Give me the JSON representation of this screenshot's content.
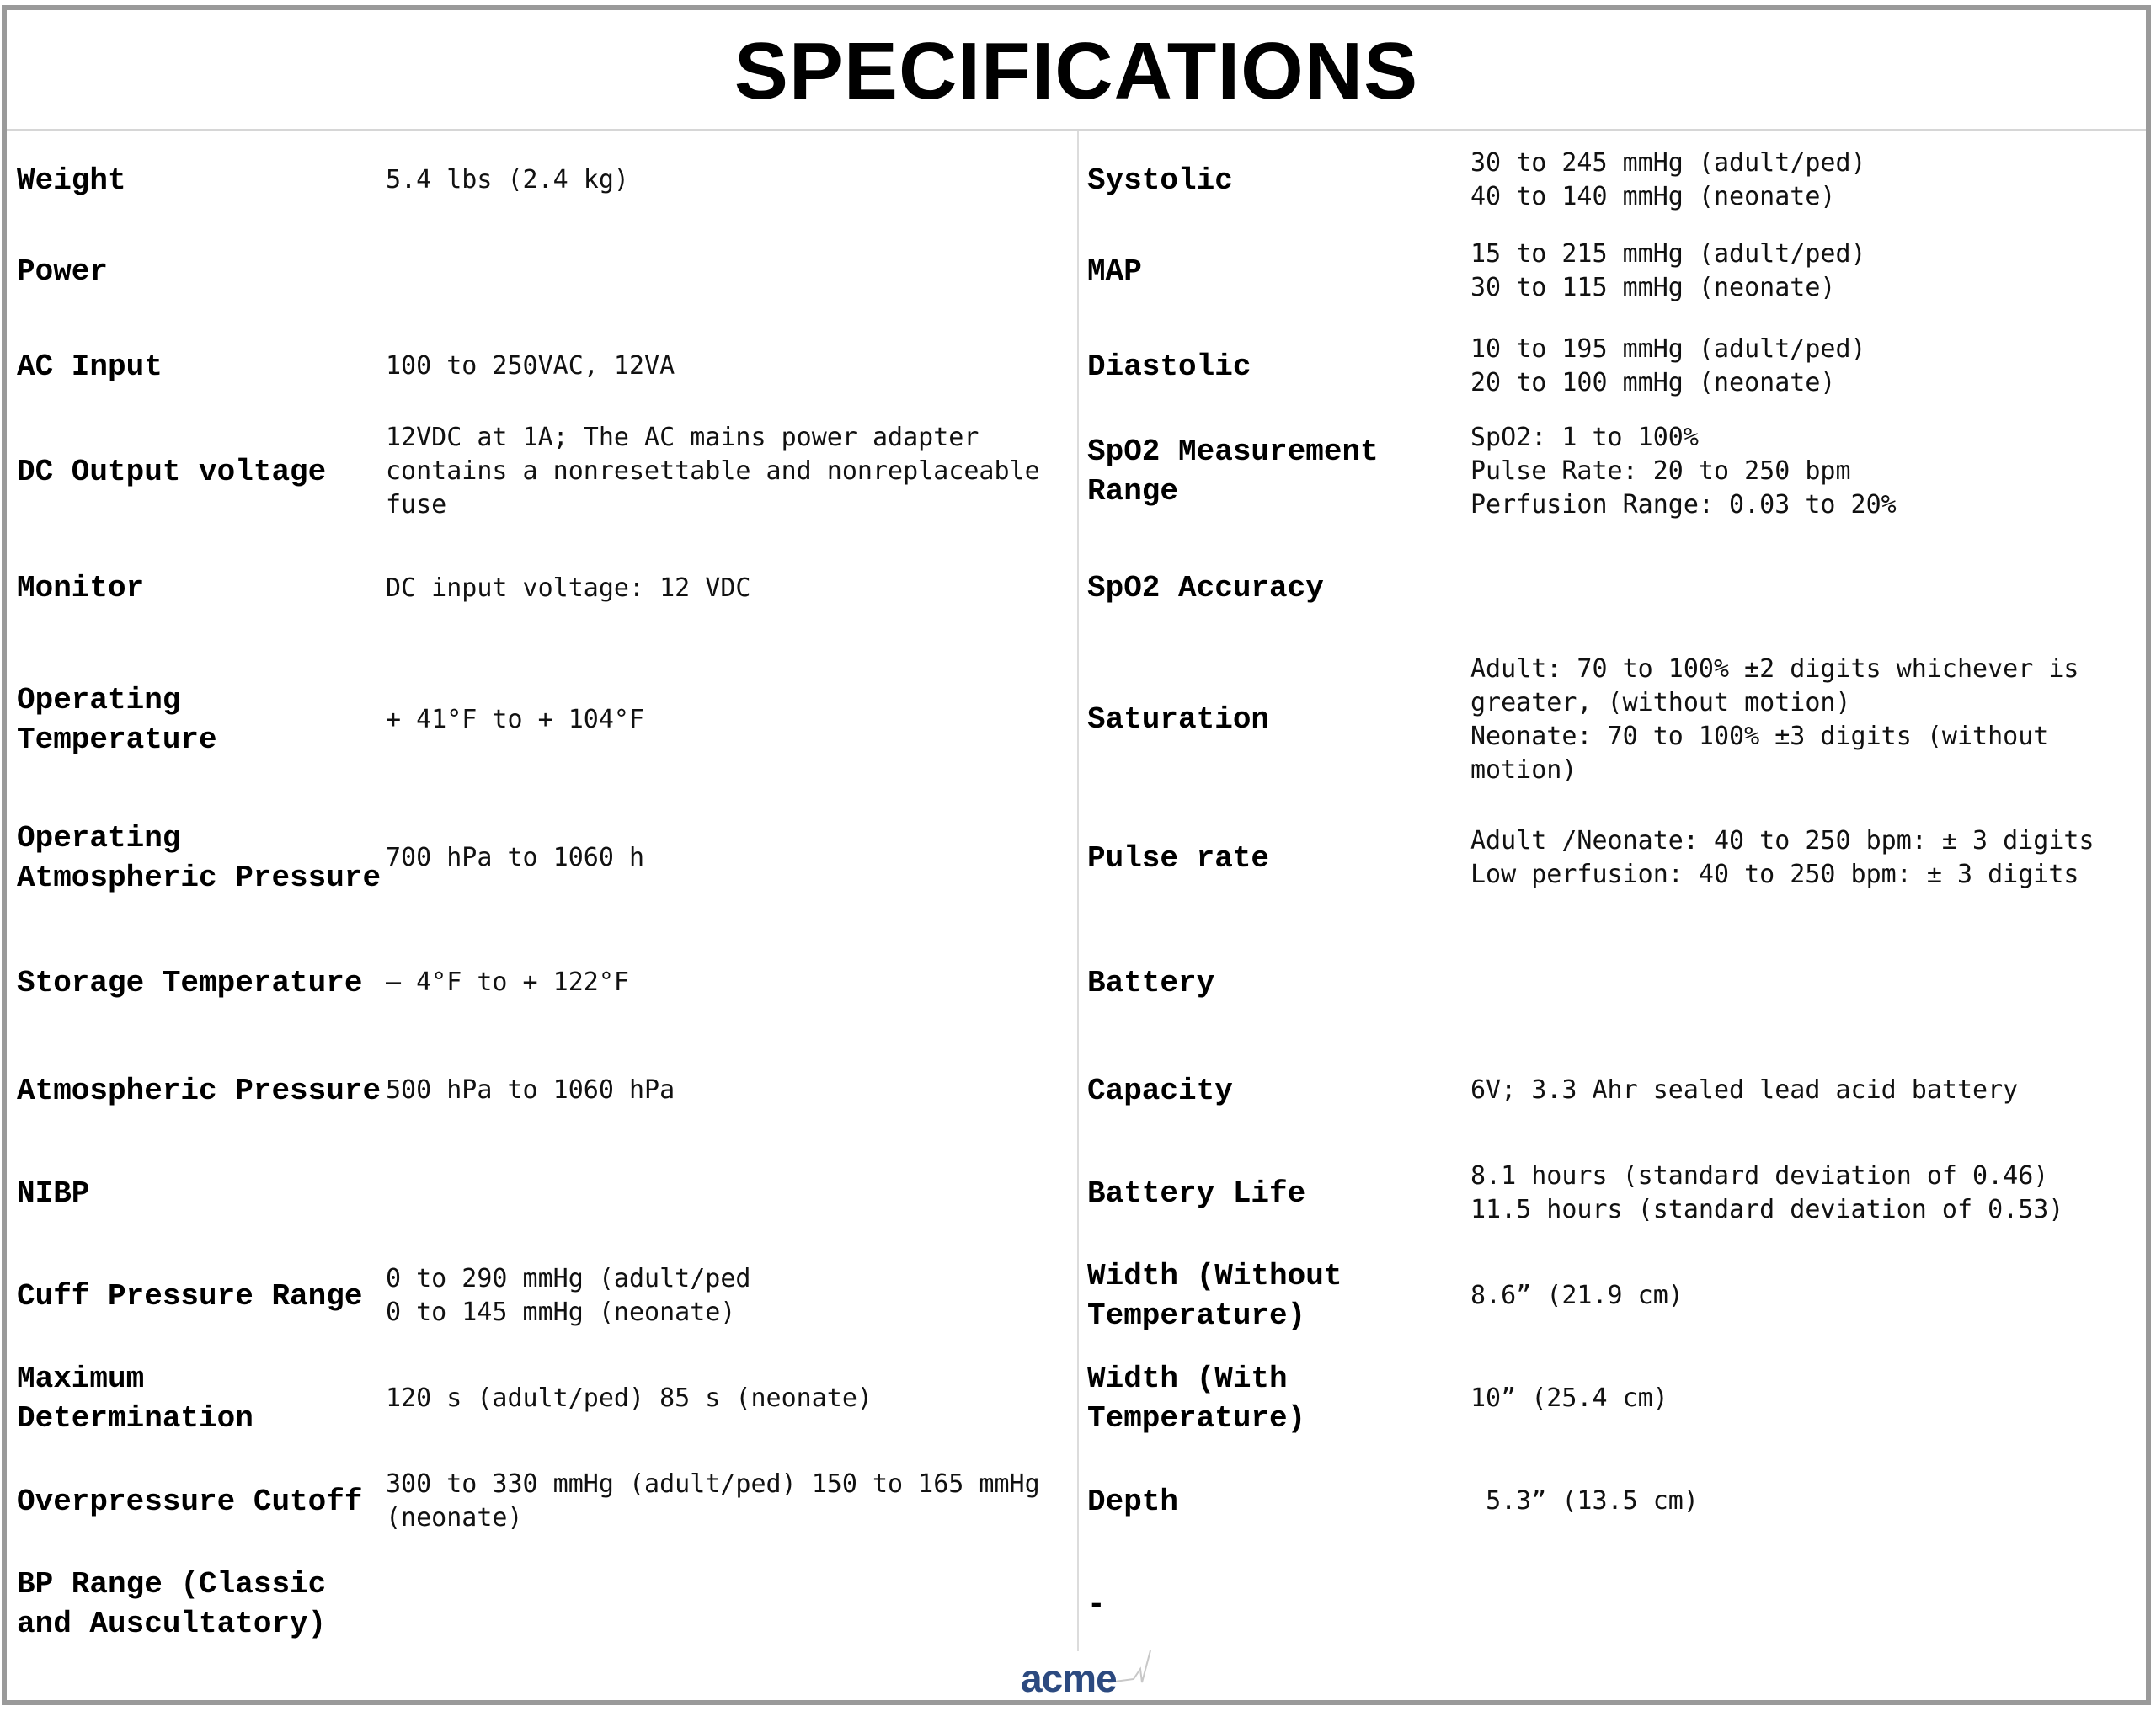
{
  "title": "SPECIFICATIONS",
  "rows": [
    {
      "left": {
        "label": "Weight",
        "value": "5.4 lbs (2.4 kg)"
      },
      "right": {
        "label": "Systolic",
        "value": "30 to 245 mmHg (adult/ped)\n40 to 140 mmHg (neonate)"
      }
    },
    {
      "left": {
        "label": "Power",
        "value": ""
      },
      "right": {
        "label": "MAP",
        "value": "15 to 215 mmHg (adult/ped)\n30 to 115 mmHg (neonate)"
      }
    },
    {
      "left": {
        "label": "AC Input",
        "value": "100 to 250VAC, 12VA"
      },
      "right": {
        "label": "Diastolic",
        "value": "10 to 195 mmHg (adult/ped)\n20 to 100 mmHg (neonate)"
      }
    },
    {
      "left": {
        "label": "DC Output voltage",
        "value": "12VDC at 1A; The AC mains power adapter contains a nonresettable and nonreplaceable fuse"
      },
      "right": {
        "label": "SpO2 Measurement Range",
        "value": "SpO2: 1 to 100%\nPulse Rate: 20 to 250 bpm\nPerfusion Range: 0.03 to 20%"
      }
    },
    {
      "left": {
        "label": "Monitor",
        "value": "DC input voltage: 12 VDC"
      },
      "right": {
        "label": "SpO2 Accuracy",
        "value": ""
      }
    },
    {
      "left": {
        "label": "Operating Temperature",
        "value": "+ 41°F to + 104°F"
      },
      "right": {
        "label": "Saturation",
        "value": "Adult: 70 to 100% ±2 digits whichever is greater, (without motion)\nNeonate: 70 to 100% ±3 digits (without motion)"
      }
    },
    {
      "left": {
        "label": "Operating Atmospheric Pressure",
        "value": "700 hPa to 1060 h"
      },
      "right": {
        "label": "Pulse rate",
        "value": "Adult /Neonate: 40 to 250 bpm: ± 3 digits\nLow perfusion: 40 to 250 bpm: ± 3 digits"
      }
    },
    {
      "left": {
        "label": "Storage Temperature",
        "value": "– 4°F to + 122°F"
      },
      "right": {
        "label": "Battery",
        "value": ""
      }
    },
    {
      "left": {
        "label": "Atmospheric Pressure",
        "value": "500 hPa to 1060 hPa"
      },
      "right": {
        "label": "Capacity",
        "value": "6V; 3.3 Ahr sealed lead acid battery"
      }
    },
    {
      "left": {
        "label": "NIBP",
        "value": ""
      },
      "right": {
        "label": "Battery Life",
        "value": "8.1 hours (standard deviation of 0.46)\n11.5 hours (standard deviation of 0.53)"
      }
    },
    {
      "left": {
        "label": "Cuff Pressure Range",
        "value": "0 to 290 mmHg (adult/ped\n0 to 145 mmHg (neonate)"
      },
      "right": {
        "label": "Width (Without Temperature)",
        "value": "8.6” (21.9 cm)"
      }
    },
    {
      "left": {
        "label": "Maximum Determination",
        "value": "120 s (adult/ped) 85 s (neonate)"
      },
      "right": {
        "label": "Width (With Temperature)",
        "value": "10” (25.4 cm)"
      }
    },
    {
      "left": {
        "label": "Overpressure Cutoff",
        "value": "300 to 330 mmHg (adult/ped) 150 to 165 mmHg (neonate)"
      },
      "right": {
        "label": "Depth",
        "value": " 5.3” (13.5 cm)"
      }
    },
    {
      "left": {
        "label": "BP Range (Classic and Auscultatory)",
        "value": ""
      },
      "right": {
        "label": "-",
        "value": ""
      }
    }
  ],
  "logo": {
    "text": "acme",
    "color": "#2c4a80",
    "icon": "pulse-line-icon"
  }
}
